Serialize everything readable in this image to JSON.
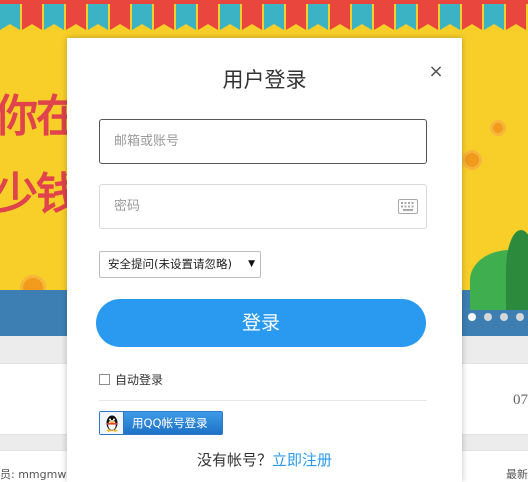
{
  "background": {
    "banner_text_1": "你在",
    "banner_text_2": "少钱",
    "card_number": "07",
    "footer_left": "员: mmgmwl",
    "footer_right": "最新"
  },
  "modal": {
    "title": "用户登录",
    "close_symbol": "×",
    "account_placeholder": "邮箱或账号",
    "password_placeholder": "密码",
    "security_question_selected": "安全提问(未设置请忽略)",
    "login_label": "登录",
    "auto_login_label": "自动登录",
    "qq_login_label": "用QQ帐号登录",
    "no_account_text": "没有帐号？",
    "register_link": "立即注册"
  },
  "icons": {
    "keyboard": "keyboard-icon",
    "qq": "qq-penguin-icon",
    "close": "close-icon",
    "dropdown": "chevron-down-icon"
  },
  "colors": {
    "primary": "#2a9af0",
    "banner_yellow": "#f8cf29",
    "banner_red": "#e0434b",
    "qq_blue": "#1e72c7"
  },
  "carousel": {
    "dot_count": 4,
    "active_index": 0
  }
}
